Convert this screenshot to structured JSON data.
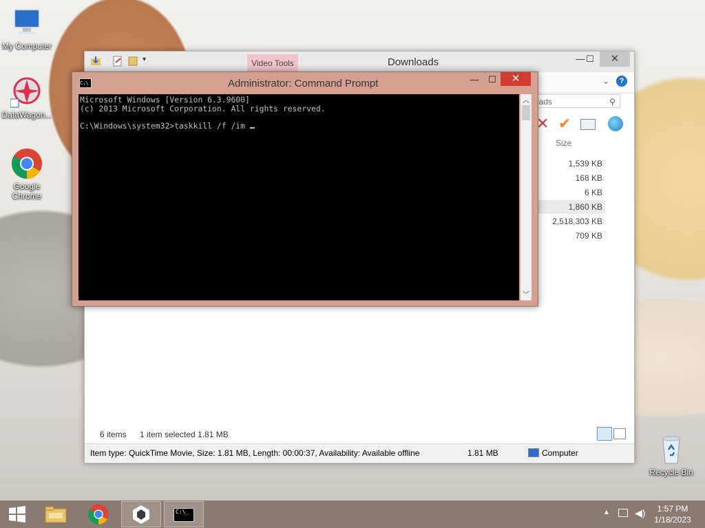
{
  "desktop": {
    "icons": [
      {
        "label": "My Computer"
      },
      {
        "label": "DataWagon..."
      },
      {
        "label": "Google Chrome"
      },
      {
        "label": "Recycle Bin"
      }
    ]
  },
  "explorer": {
    "title": "Downloads",
    "context_tab": "Video Tools",
    "search_placeholder": "oads",
    "column_size": "Size",
    "sizes": [
      "1,539 KB",
      "168 KB",
      "6 KB",
      "1,860 KB",
      "2,518,303 KB",
      "709 KB"
    ],
    "status_items": "6 items",
    "status_selected": "1 item selected  1.81 MB",
    "details_text": "Item type: QuickTime Movie, Size: 1.81 MB, Length: 00:00:37, Availability: Available offline",
    "details_size": "1.81 MB",
    "details_location": "Computer"
  },
  "cmd": {
    "title": "Administrator:  Command Prompt",
    "line1": "Microsoft Windows [Version 6.3.9600]",
    "line2": "(c) 2013 Microsoft Corporation. All rights reserved.",
    "prompt": "C:\\Windows\\system32>taskkill /f /im "
  },
  "taskbar": {
    "time": "1:57 PM",
    "date": "1/18/2023",
    "cmd_thumb": "C:\\_"
  },
  "colors": {
    "cmd_frame": "#d6a090",
    "taskbar": "#8b7a71",
    "close_red": "#d33b30"
  }
}
